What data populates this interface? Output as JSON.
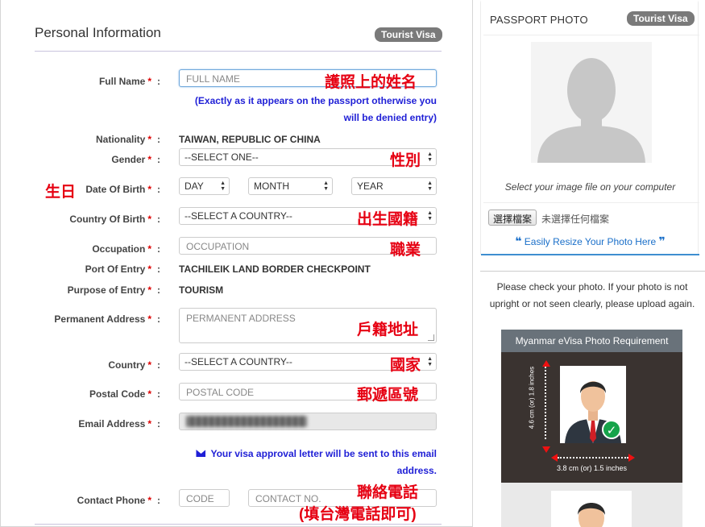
{
  "form": {
    "title": "Personal Information",
    "badge": "Tourist Visa",
    "colon": ":",
    "required_mark": "*",
    "full_name": {
      "label": "Full Name",
      "placeholder": "FULL NAME",
      "annotation": "護照上的姓名"
    },
    "passport_note_line1": "(Exactly as it appears on the passport otherwise you",
    "passport_note_line2": "will be denied entry)",
    "nationality": {
      "label": "Nationality",
      "value": "TAIWAN, REPUBLIC OF CHINA"
    },
    "gender": {
      "label": "Gender",
      "value": "--SELECT ONE--",
      "annotation": "性別"
    },
    "dob": {
      "label": "Date Of Birth",
      "day": "DAY",
      "month": "MONTH",
      "year": "YEAR",
      "annotation": "生日"
    },
    "country_of_birth": {
      "label": "Country Of Birth",
      "value": "--SELECT A COUNTRY--",
      "annotation": "出生國籍"
    },
    "occupation": {
      "label": "Occupation",
      "placeholder": "OCCUPATION",
      "annotation": "職業"
    },
    "port_of_entry": {
      "label": "Port Of Entry",
      "value": "TACHILEIK LAND BORDER CHECKPOINT"
    },
    "purpose_of_entry": {
      "label": "Purpose of Entry",
      "value": "TOURISM"
    },
    "permanent_address": {
      "label": "Permanent Address",
      "placeholder": "PERMANENT ADDRESS",
      "annotation": "戶籍地址"
    },
    "country": {
      "label": "Country",
      "value": "--SELECT A COUNTRY--",
      "annotation": "國家"
    },
    "postal_code": {
      "label": "Postal Code",
      "placeholder": "POSTAL CODE",
      "annotation": "郵遞區號"
    },
    "email": {
      "label": "Email Address"
    },
    "email_note_line1": "Your visa approval letter will be sent to this email",
    "email_note_line2": "address.",
    "contact_phone": {
      "label": "Contact Phone",
      "code_placeholder": "CODE",
      "number_placeholder": "CONTACT NO.",
      "annotation_line1": "聯絡電話",
      "annotation_line2": "(填台灣電話即可)"
    }
  },
  "passport_photo": {
    "title": "PASSPORT PHOTO",
    "badge": "Tourist Visa",
    "select_caption": "Select your image file on your computer",
    "file_button": "選擇檔案",
    "file_status": "未選擇任何檔案",
    "resize_link": "Easily Resize Your Photo Here",
    "check_text": "Please check your photo. If your photo is not upright or not seen clearly, please upload again.",
    "requirement_title": "Myanmar eVisa Photo Requirement",
    "height_text": "4.6 cm (or) 1.8 inches",
    "width_text": "3.8 cm (or) 1.5 inches"
  },
  "icons": [
    "envelope-icon",
    "quote-left-icon",
    "quote-right-icon",
    "select-arrows-icon",
    "checkmark-icon",
    "avatar-placeholder-icon"
  ]
}
